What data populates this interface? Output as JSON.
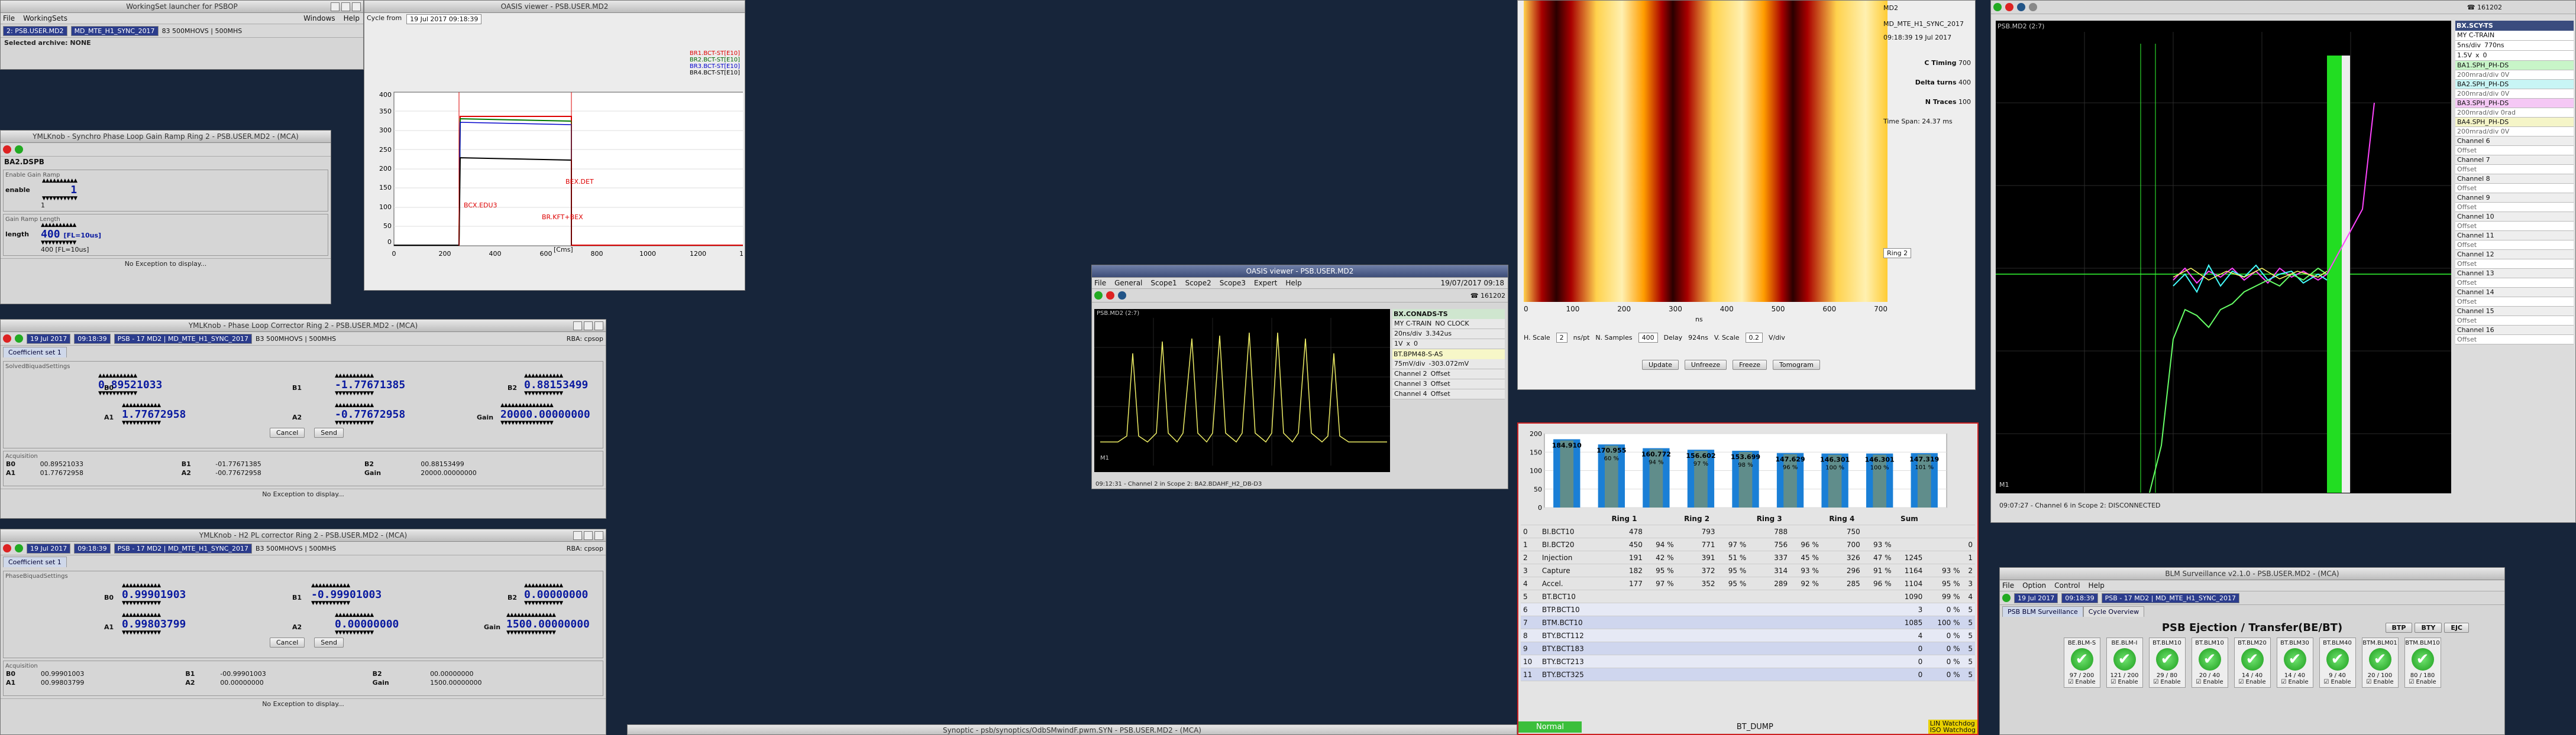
{
  "workingset": {
    "title": "WorkingSet launcher for PSBOP",
    "menu": [
      "File",
      "WorkingSets",
      "Windows",
      "Help"
    ],
    "user": "2: PSB.USER.MD2",
    "user_extra": "MD_MTE_H1_SYNC_2017",
    "cycles": "83 500MHOVS | 500MHS",
    "archive": "Selected archive: NONE"
  },
  "pll_window": {
    "title": "YMLKnob - Synchro Phase Loop Gain Ramp Ring 2 - PSB.USER.MD2 - (MCA)",
    "device": "BA2.DSPB",
    "enable_section": "Enable Gain Ramp",
    "enable_label": "enable",
    "enable_value": "1",
    "enable_readback": "1",
    "length_section": "Gain Ramp Length",
    "length_label": "length",
    "length_value": "400",
    "length_unit": "[FL=10us]",
    "length_readback": "400 [FL=10us]",
    "status": "No Exception to display..."
  },
  "oasis_small": {
    "title": "OASIS viewer - PSB.USER.MD2",
    "cycle_label": "Cycle from",
    "cycle_value": "19 Jul 2017 09:18:39",
    "legend": [
      "BR1.BCT-ST[E10]",
      "BR2.BCT-ST[E10]",
      "BR3.BCT-ST[E10]",
      "BR4.BCT-ST[E10]"
    ],
    "marker_inj": "BCX.EDU3",
    "marker_kick": "BEX.DET",
    "marker_ext": "BR.KFT+BEX",
    "xunit": "[Cms]",
    "yticks": [
      "400",
      "350",
      "300",
      "250",
      "200",
      "150",
      "100",
      "50",
      "0",
      "-50"
    ],
    "xticks": [
      "0",
      "200",
      "400",
      "600",
      "800",
      "1000",
      "1200",
      "1400"
    ]
  },
  "coeff_windows": [
    {
      "title": "YMLKnob - Phase Loop Corrector Ring 2 - PSB.USER.MD2 - (MCA)",
      "date": "19 Jul 2017",
      "time": "09:18:39",
      "cycle": "PSB - 17 MD2 | MD_MTE_H1_SYNC_2017",
      "modes": "B3 500MHOVS | 500MHS",
      "rba": "RBA: cpsop",
      "tab": "Coefficient set 1",
      "section": "SolvedBiquadSettings",
      "B0": "0.89521033",
      "B1": "-1.77671385",
      "B2": "0.88153499",
      "A1": "1.77672958",
      "A2": "-0.77672958",
      "Gain": "20000.00000000",
      "labels": {
        "B0": "B0",
        "B1": "B1",
        "B2": "B2",
        "A1": "A1",
        "A2": "A2",
        "Gain": "Gain"
      },
      "cancel": "Cancel",
      "send": "Send",
      "acq_title": "Acquisition",
      "acq": [
        [
          "B0",
          "00.89521033",
          "B1",
          "-01.77671385",
          "B2",
          "00.88153499"
        ],
        [
          "A1",
          "01.77672958",
          "A2",
          "-00.77672958",
          "Gain",
          "20000.00000000"
        ]
      ],
      "status": "No Exception to display..."
    },
    {
      "title": "YMLKnob - H2 PL corrector Ring 2 - PSB.USER.MD2 - (MCA)",
      "date": "19 Jul 2017",
      "time": "09:18:39",
      "cycle": "PSB - 17 MD2 | MD_MTE_H1_SYNC_2017",
      "modes": "B3 500MHOVS | 500MHS",
      "rba": "RBA: cpsop",
      "tab": "Coefficient set 1",
      "section": "PhaseBiquadSettings",
      "B0": "0.99901903",
      "B1": "-0.99901003",
      "B2": "0.00000000",
      "A1": "0.99803799",
      "A2": "0.00000000",
      "Gain": "1500.00000000",
      "labels": {
        "B0": "B0",
        "B1": "B1",
        "B2": "B2",
        "A1": "A1",
        "A2": "A2",
        "Gain": "Gain"
      },
      "cancel": "Cancel",
      "send": "Send",
      "acq_title": "Acquisition",
      "acq": [
        [
          "B0",
          "00.99901003",
          "B1",
          "-00.99901003",
          "B2",
          "00.00000000"
        ],
        [
          "A1",
          "00.99803799",
          "A2",
          "00.00000000",
          "Gain",
          "1500.00000000"
        ]
      ],
      "status": "No Exception to display..."
    }
  ],
  "oasis_scope": {
    "title": "OASIS viewer - PSB.USER.MD2",
    "menu": [
      "File",
      "General",
      "Scope1",
      "Scope2",
      "Scope3",
      "Expert",
      "Help"
    ],
    "date": "19/07/2017 09:18",
    "phone": "161202",
    "plot_title": "PSB.MD2 (2:7)",
    "signal": "BX.CONADS-TS",
    "fields": [
      [
        "MY C-TRAIN",
        "NO CLOCK"
      ],
      [
        "20ns/div",
        "3.342us"
      ],
      [
        "1V",
        "x",
        "0"
      ]
    ],
    "channel_main": "BT.BPM48-S-AS",
    "channel_main_vals": [
      "75mV/div",
      "-303.072mV"
    ],
    "channels": [
      "Channel 2",
      "Channel 3",
      "Channel 4"
    ],
    "offset_label": "Offset",
    "status": "09:12:31 - Channel 2 in Scope 2: BA2.BDAHF_H2_DB-D3",
    "marker": "M1"
  },
  "mountain": {
    "xticks": [
      "0",
      "100",
      "200",
      "300",
      "400",
      "500",
      "600",
      "700"
    ],
    "xunit": "ns",
    "hscale_label": "H. Scale",
    "hscale_value": "2",
    "hscale_unit": "ns/pt",
    "nsamples_label": "N. Samples",
    "nsamples_value": "400",
    "delay_label": "Delay",
    "delay_value": "924ns",
    "vscale_label": "V. Scale",
    "vscale_value": "0.2",
    "vscale_unit": "V/div",
    "buttons": [
      "Update",
      "Unfreeze",
      "Freeze",
      "Tomogram"
    ],
    "side": {
      "title": "MD2",
      "cycle": "MD_MTE_H1_SYNC_2017",
      "time": "09:18:39 19 Jul 2017",
      "ctiming_label": "C Timing",
      "ctiming_value": "700",
      "dturns_label": "Delta turns",
      "dturns_value": "400",
      "ntraces_label": "N Traces",
      "ntraces_value": "100",
      "timespan": "Time Span: 24.37 ms",
      "ring": "Ring 2"
    }
  },
  "bt_table": {
    "chart_data": {
      "type": "bar",
      "categories": [
        "1",
        "2",
        "3",
        "4",
        "5",
        "6",
        "7",
        "8",
        "9"
      ],
      "values": [
        184.9,
        170.9,
        160.7,
        156.6,
        153.7,
        147.6,
        146.3,
        146.3,
        147.3
      ],
      "labels": [
        "184.910",
        "170.955",
        "160.772",
        "156.602",
        "153.699",
        "147.629",
        "146.301",
        "146.301",
        "147.319"
      ],
      "pct": [
        "",
        "60 %",
        "94 %",
        "97 %",
        "98 %",
        "96 %",
        "100 %",
        "100 %",
        "101 %"
      ],
      "ylim": [
        0,
        200
      ],
      "yticks": [
        "200",
        "150",
        "100",
        "50",
        "0"
      ],
      "series_colors": [
        "#1a7fd6",
        "#e5a800"
      ]
    },
    "headers": [
      "",
      "",
      "Ring 1",
      "",
      "Ring 2",
      "",
      "Ring 3",
      "",
      "Ring 4",
      "",
      "Sum",
      "",
      ""
    ],
    "rows": [
      [
        "0",
        "BI.BCT10",
        "478",
        "",
        "793",
        "",
        "788",
        "",
        "750",
        "",
        "",
        "",
        ""
      ],
      [
        "1",
        "BI.BCT20",
        "450",
        "94 %",
        "771",
        "97 %",
        "756",
        "96 %",
        "700",
        "93 %",
        "",
        "",
        "0"
      ],
      [
        "2",
        "Injection",
        "191",
        "42 %",
        "391",
        "51 %",
        "337",
        "45 %",
        "326",
        "47 %",
        "1245",
        "",
        "1"
      ],
      [
        "3",
        "Capture",
        "182",
        "95 %",
        "372",
        "95 %",
        "314",
        "93 %",
        "296",
        "91 %",
        "1164",
        "93 %",
        "2"
      ],
      [
        "4",
        "Accel.",
        "177",
        "97 %",
        "352",
        "95 %",
        "289",
        "92 %",
        "285",
        "96 %",
        "1104",
        "95 %",
        "3"
      ],
      [
        "5",
        "BT.BCT10",
        "",
        "",
        "",
        "",
        "",
        "",
        "",
        "",
        "1090",
        "99 %",
        "4"
      ],
      [
        "6",
        "BTP.BCT10",
        "",
        "",
        "",
        "",
        "",
        "",
        "",
        "",
        "3",
        "0 %",
        "5"
      ],
      [
        "7",
        "BTM.BCT10",
        "",
        "",
        "",
        "",
        "",
        "",
        "",
        "",
        "1085",
        "100 %",
        "5"
      ],
      [
        "8",
        "BTY.BCT112",
        "",
        "",
        "",
        "",
        "",
        "",
        "",
        "",
        "4",
        "0 %",
        "5"
      ],
      [
        "9",
        "BTY.BCT183",
        "",
        "",
        "",
        "",
        "",
        "",
        "",
        "",
        "0",
        "0 %",
        "5"
      ],
      [
        "10",
        "BTY.BCT213",
        "",
        "",
        "",
        "",
        "",
        "",
        "",
        "",
        "0",
        "0 %",
        "5"
      ],
      [
        "11",
        "BTY.BCT325",
        "",
        "",
        "",
        "",
        "",
        "",
        "",
        "",
        "0",
        "0 %",
        "5"
      ]
    ],
    "footer_normal": "Normal",
    "footer_dump": "BT_DUMP",
    "footer_lin": "LIN Watchdog",
    "footer_iso": "ISO Watchdog"
  },
  "right_scope": {
    "phone": "161202",
    "plot_title": "PSB.MD2 (2:7)",
    "signal": "BX.SCY-TS",
    "sig_fields": [
      [
        "MY C-TRAIN",
        ""
      ],
      [
        "5ns/div",
        "770ns"
      ],
      [
        "1.5V",
        "x",
        "0"
      ]
    ],
    "channels": [
      {
        "name": "BA1.SPH_PH-DS",
        "val": "200mrad/div 0V",
        "color": "#c8f5c8"
      },
      {
        "name": "BA2.SPH_PH-DS",
        "val": "200mrad/div 0V",
        "color": "#c8f5f5"
      },
      {
        "name": "BA3.SPH_PH-DS",
        "val": "200mrad/div 0rad",
        "color": "#f5c8f5"
      },
      {
        "name": "BA4.SPH_PH-DS",
        "val": "200mrad/div 0V",
        "color": "#f5f5c8"
      },
      {
        "name": "Channel 6",
        "val": "Offset",
        "color": "#eee"
      },
      {
        "name": "Channel 7",
        "val": "Offset",
        "color": "#eee"
      },
      {
        "name": "Channel 8",
        "val": "Offset",
        "color": "#eee"
      },
      {
        "name": "Channel 9",
        "val": "Offset",
        "color": "#eee"
      },
      {
        "name": "Channel 10",
        "val": "Offset",
        "color": "#eee"
      },
      {
        "name": "Channel 11",
        "val": "Offset",
        "color": "#eee"
      },
      {
        "name": "Channel 12",
        "val": "Offset",
        "color": "#eee"
      },
      {
        "name": "Channel 13",
        "val": "Offset",
        "color": "#eee"
      },
      {
        "name": "Channel 14",
        "val": "Offset",
        "color": "#eee"
      },
      {
        "name": "Channel 15",
        "val": "Offset",
        "color": "#eee"
      },
      {
        "name": "Channel 16",
        "val": "Offset",
        "color": "#eee"
      }
    ],
    "status": "09:07:27 - Channel 6 in Scope 2: DISCONNECTED",
    "marker": "M1"
  },
  "blm": {
    "title": "BLM Surveillance v2.1.0 - PSB.USER.MD2 - (MCA)",
    "menu": [
      "File",
      "Option",
      "Control",
      "Help"
    ],
    "date": "19 Jul 2017",
    "time": "09:18:39",
    "cycle": "PSB - 17 MD2 | MD_MTE_H1_SYNC_2017",
    "tabs": [
      "PSB BLM Surveillance",
      "Cycle Overview"
    ],
    "heading": "PSB Ejection / Transfer(BE/BT)",
    "heading_btns": [
      "BTP",
      "BTY",
      "EJC"
    ],
    "enable_label": "Enable",
    "monitors": [
      {
        "name": "BE.BLM-S",
        "val": "97 / 200"
      },
      {
        "name": "BE.BLM-I",
        "val": "121 / 200"
      },
      {
        "name": "BT.BLM10",
        "val": "29 / 80"
      },
      {
        "name": "BT.BLM10",
        "val": "20 / 40"
      },
      {
        "name": "BT.BLM20",
        "val": "14 / 40"
      },
      {
        "name": "BT.BLM30",
        "val": "14 / 40"
      },
      {
        "name": "BT.BLM40",
        "val": "9 / 40"
      },
      {
        "name": "BTM.BLM01",
        "val": "20 / 100"
      },
      {
        "name": "BTM.BLM10",
        "val": "80 / 180"
      }
    ]
  },
  "bottom_bar": {
    "title": "Synoptic - psb/synoptics/OdbSMwindF.pwm.SYN - PSB.USER.MD2 - (MCA)"
  }
}
